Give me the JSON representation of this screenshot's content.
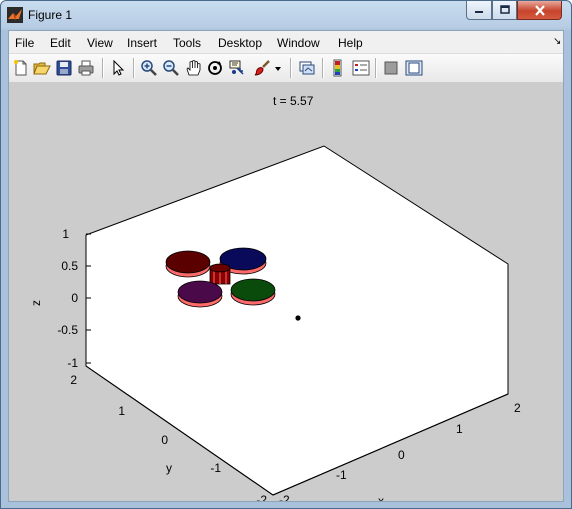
{
  "window": {
    "title": "Figure 1",
    "controls": {
      "minimize": "minimize",
      "maximize": "maximize",
      "close": "close"
    }
  },
  "menu": {
    "items": [
      {
        "label": "File"
      },
      {
        "label": "Edit"
      },
      {
        "label": "View"
      },
      {
        "label": "Insert"
      },
      {
        "label": "Tools"
      },
      {
        "label": "Desktop"
      },
      {
        "label": "Window"
      },
      {
        "label": "Help"
      }
    ],
    "dock_arrow": "↘"
  },
  "toolbar": {
    "icons": [
      "new-figure-icon",
      "open-file-icon",
      "save-icon",
      "print-icon",
      "edit-plot-arrow-icon",
      "zoom-in-icon",
      "zoom-out-icon",
      "pan-hand-icon",
      "rotate-3d-icon",
      "data-cursor-icon",
      "brush-icon",
      "brush-dropdown-icon",
      "link-plot-icon",
      "colorbar-icon",
      "legend-icon",
      "hide-plot-tools-icon",
      "show-plot-tools-icon"
    ]
  },
  "plot": {
    "title": "t = 5.57",
    "xlabel": "x",
    "ylabel": "y",
    "zlabel": "z",
    "z_ticks": [
      "1",
      "0.5",
      "0",
      "-0.5",
      "-1"
    ],
    "y_ticks": [
      "2",
      "1",
      "0",
      "-1",
      "-2"
    ],
    "x_ticks": [
      "-2",
      "-1",
      "0",
      "1",
      "2"
    ],
    "rotor_colors": [
      "#5a0000",
      "#0a0a5a",
      "#4a0a4a",
      "#0a4a0a"
    ],
    "hub_color": "#8b0000",
    "stripe_color": "#ff6a6a",
    "point_color": "#000000",
    "background": "#ffffff",
    "figure_bg": "#cccccc"
  }
}
